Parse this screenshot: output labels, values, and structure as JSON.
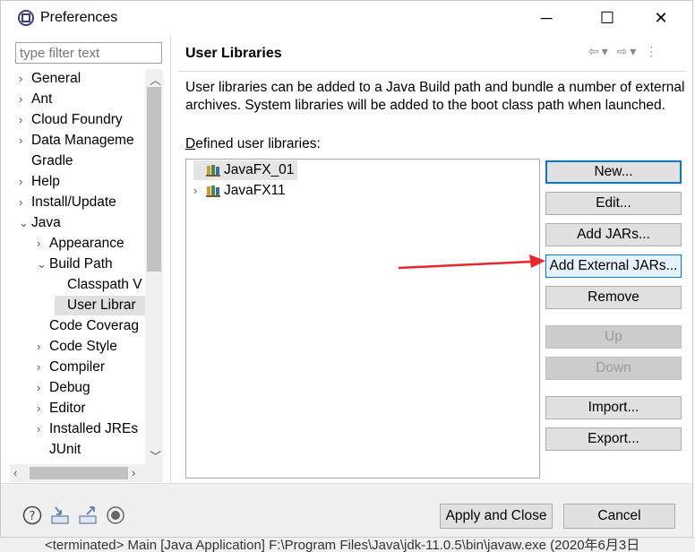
{
  "window": {
    "title": "Preferences",
    "minimize": "─",
    "maximize": "☐",
    "close": "✕"
  },
  "filter": {
    "placeholder": "type filter text"
  },
  "tree": [
    {
      "label": "General",
      "indent": 0,
      "twisty": "›"
    },
    {
      "label": "Ant",
      "indent": 0,
      "twisty": "›"
    },
    {
      "label": "Cloud Foundry",
      "indent": 0,
      "twisty": "›"
    },
    {
      "label": "Data Manageme",
      "indent": 0,
      "twisty": "›"
    },
    {
      "label": "Gradle",
      "indent": 0,
      "twisty": ""
    },
    {
      "label": "Help",
      "indent": 0,
      "twisty": "›"
    },
    {
      "label": "Install/Update",
      "indent": 0,
      "twisty": "›"
    },
    {
      "label": "Java",
      "indent": 0,
      "twisty": "⌄"
    },
    {
      "label": "Appearance",
      "indent": 1,
      "twisty": "›"
    },
    {
      "label": "Build Path",
      "indent": 1,
      "twisty": "⌄"
    },
    {
      "label": "Classpath V",
      "indent": 2,
      "twisty": ""
    },
    {
      "label": "User Librar",
      "indent": 2,
      "twisty": "",
      "selected": true
    },
    {
      "label": "Code Coverag",
      "indent": 1,
      "twisty": ""
    },
    {
      "label": "Code Style",
      "indent": 1,
      "twisty": "›"
    },
    {
      "label": "Compiler",
      "indent": 1,
      "twisty": "›"
    },
    {
      "label": "Debug",
      "indent": 1,
      "twisty": "›"
    },
    {
      "label": "Editor",
      "indent": 1,
      "twisty": "›"
    },
    {
      "label": "Installed JREs",
      "indent": 1,
      "twisty": "›"
    },
    {
      "label": "JUnit",
      "indent": 1,
      "twisty": ""
    }
  ],
  "page": {
    "title": "User Libraries",
    "description": "User libraries can be added to a Java Build path and bundle a number of external archives. System libraries will be added to the boot class path when launched.",
    "defined_label": "Defined user libraries:",
    "libraries": [
      {
        "label": "JavaFX_01",
        "selected": true,
        "twisty": ""
      },
      {
        "label": "JavaFX11",
        "selected": false,
        "twisty": "›"
      }
    ]
  },
  "buttons": {
    "new": "New...",
    "edit": "Edit...",
    "add_jars": "Add JARs...",
    "add_external_jars": "Add External JARs...",
    "remove": "Remove",
    "up": "Up",
    "down": "Down",
    "import": "Import...",
    "export": "Export..."
  },
  "footer": {
    "apply_close": "Apply and Close",
    "cancel": "Cancel"
  },
  "background": {
    "console_line": "<terminated> Main [Java Application] F:\\Program Files\\Java\\jdk-11.0.5\\bin\\javaw.exe (2020年6月3日"
  },
  "colors": {
    "accent": "#0078d7",
    "arrow": "#e8262b"
  }
}
